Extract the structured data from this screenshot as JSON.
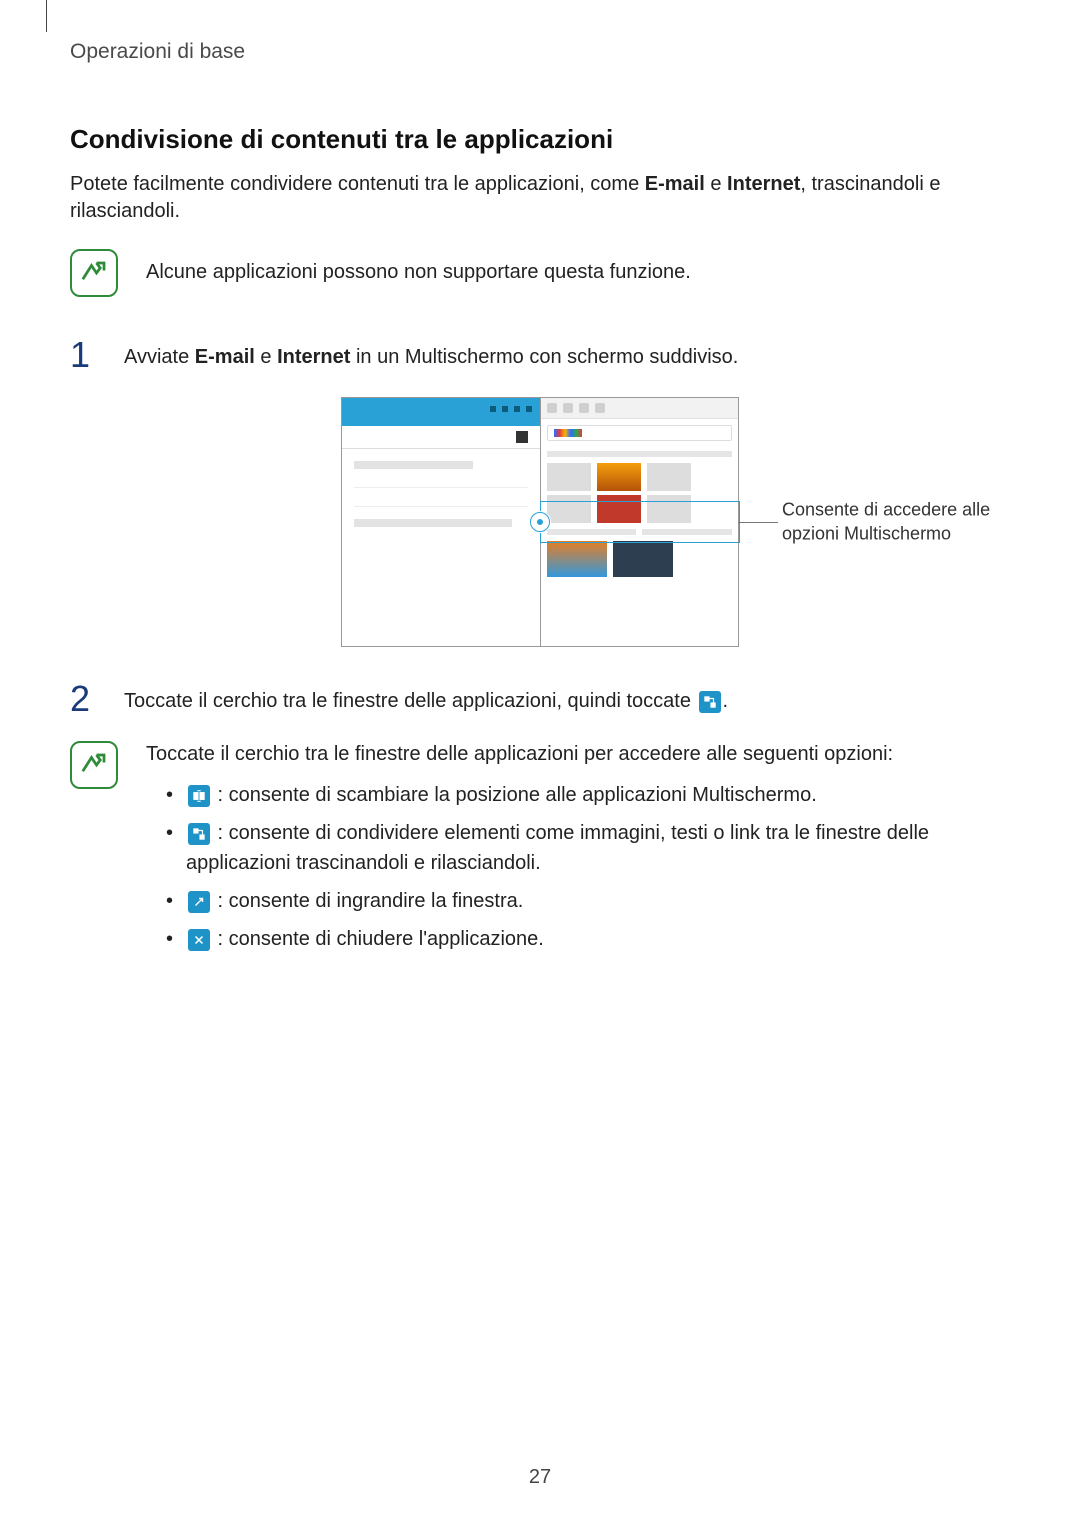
{
  "runningHeader": "Operazioni di base",
  "subheading": "Condivisione di contenuti tra le applicazioni",
  "intro": {
    "prefix": "Potete facilmente condividere contenuti tra le applicazioni, come ",
    "bold1": "E-mail",
    "mid": " e ",
    "bold2": "Internet",
    "suffix": ", trascinandoli e rilasciandoli."
  },
  "note1": "Alcune applicazioni possono non supportare questa funzione.",
  "step1": {
    "num": "1",
    "prefix": "Avviate ",
    "bold1": "E-mail",
    "mid": " e ",
    "bold2": "Internet",
    "suffix": " in un Multischermo con schermo suddiviso."
  },
  "callout": "Consente di accedere alle opzioni Multischermo",
  "step2": {
    "num": "2",
    "prefix": "Toccate il cerchio tra le finestre delle applicazioni, quindi toccate ",
    "suffix": "."
  },
  "note2": {
    "intro": "Toccate il cerchio tra le finestre delle applicazioni per accedere alle seguenti opzioni:",
    "b1": " : consente di scambiare la posizione alle applicazioni Multischermo.",
    "b2": " : consente di condividere elementi come immagini, testi o link tra le finestre delle applicazioni trascinandoli e rilasciandoli.",
    "b3": " : consente di ingrandire la finestra.",
    "b4": " : consente di chiudere l'applicazione."
  },
  "pageNumber": "27"
}
